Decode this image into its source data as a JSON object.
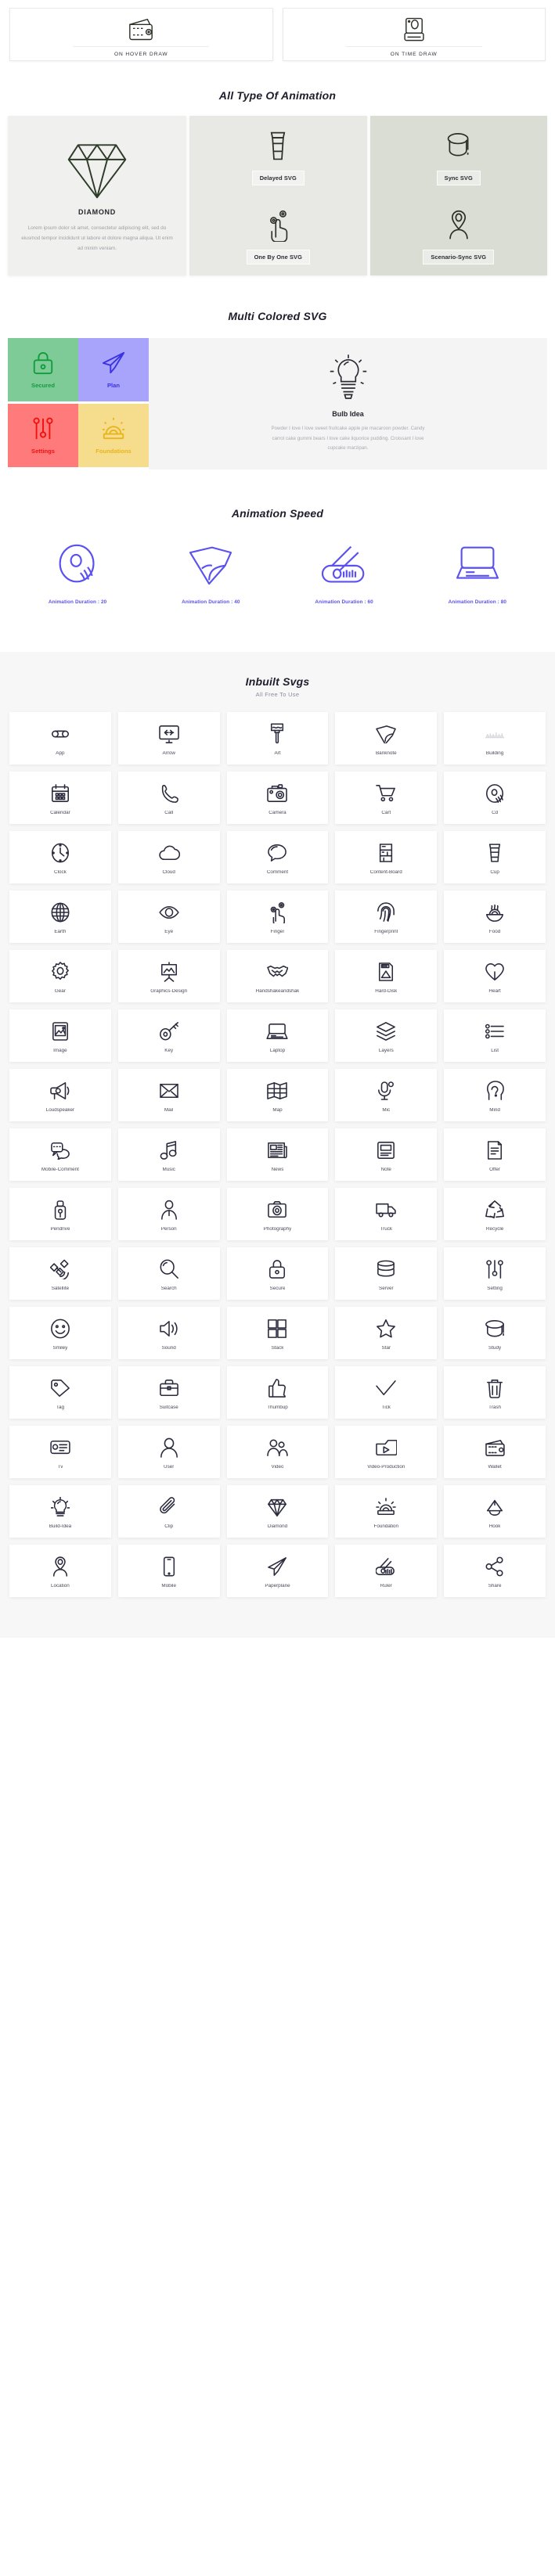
{
  "draw_cards": [
    {
      "label": "ON HOVER DRAW",
      "icon": "wallet-icon"
    },
    {
      "label": "ON TIME DRAW",
      "icon": "camera-icon"
    }
  ],
  "animation_types": {
    "title": "All Type Of Animation",
    "feature": {
      "icon": "diamond-icon",
      "title": "DIAMOND",
      "body": "Lorem ipsum dolor sit amet, consectetur adipiscing elit, sed do eiusmod tempor incididunt ut labore et dolore magna aliqua. Ut enim ad minim veniam."
    },
    "columns": [
      {
        "cells": [
          {
            "icon": "coffee-cup-icon",
            "label": "Delayed SVG"
          },
          {
            "icon": "finger-tap-icon",
            "label": "One By One SVG"
          }
        ]
      },
      {
        "cells": [
          {
            "icon": "graduation-cap-icon",
            "label": "Sync SVG"
          },
          {
            "icon": "location-person-icon",
            "label": "Scenario-Sync SVG"
          }
        ]
      }
    ]
  },
  "multi_colored": {
    "title": "Multi Colored SVG",
    "tiles": [
      {
        "label": "Secured",
        "icon": "lock-icon",
        "bg": "#7ECB97",
        "fg": "#0F9D3C"
      },
      {
        "label": "Plan",
        "icon": "paperplane-icon",
        "bg": "#A8A3FB",
        "fg": "#3B33E0"
      },
      {
        "label": "Settings",
        "icon": "sliders-icon",
        "bg": "#FF7B7B",
        "fg": "#F01010"
      },
      {
        "label": "Foundations",
        "icon": "siren-icon",
        "bg": "#F6DC8D",
        "fg": "#E8B61C"
      }
    ],
    "panel": {
      "icon": "bulb-icon",
      "title": "Bulb Idea",
      "body": "Powder I love I love sweet fruitcake apple pie macaroon powder. Candy carrot cake gummi bears I love cake liquorice pudding. Croissant I love cupcake marzipan."
    }
  },
  "animation_speed": {
    "title": "Animation Speed",
    "accent": "#5A51F0",
    "items": [
      {
        "icon": "cd-icon",
        "label": "Animation Duration : 20"
      },
      {
        "icon": "banknote-icon",
        "label": "Animation Duration : 40"
      },
      {
        "icon": "ruler-icon",
        "label": "Animation Duration : 60"
      },
      {
        "icon": "laptop-icon",
        "label": "Animation Duration : 80"
      }
    ]
  },
  "inbuilt": {
    "title": "Inbuilt Svgs",
    "subtitle": "All Free To Use",
    "icons": [
      {
        "label": "App",
        "icon": "app-icon"
      },
      {
        "label": "Arrow",
        "icon": "arrow-icon"
      },
      {
        "label": "Art",
        "icon": "art-icon"
      },
      {
        "label": "Banknote",
        "icon": "banknote-icon"
      },
      {
        "label": "Building",
        "icon": "building-icon"
      },
      {
        "label": "Calendar",
        "icon": "calendar-icon"
      },
      {
        "label": "Call",
        "icon": "call-icon"
      },
      {
        "label": "Camera",
        "icon": "camera-icon"
      },
      {
        "label": "Cart",
        "icon": "cart-icon"
      },
      {
        "label": "Cd",
        "icon": "cd-icon"
      },
      {
        "label": "Clock",
        "icon": "clock-icon"
      },
      {
        "label": "Cloud",
        "icon": "cloud-icon"
      },
      {
        "label": "Comment",
        "icon": "comment-icon"
      },
      {
        "label": "Content-Board",
        "icon": "content-board-icon"
      },
      {
        "label": "Cup",
        "icon": "cup-icon"
      },
      {
        "label": "Earth",
        "icon": "earth-icon"
      },
      {
        "label": "Eye",
        "icon": "eye-icon"
      },
      {
        "label": "Finger",
        "icon": "finger-icon"
      },
      {
        "label": "Fingerprint",
        "icon": "fingerprint-icon"
      },
      {
        "label": "Food",
        "icon": "food-icon"
      },
      {
        "label": "Gear",
        "icon": "gear-icon"
      },
      {
        "label": "Graphics-Design",
        "icon": "graphics-design-icon"
      },
      {
        "label": "Handshakeandshak",
        "icon": "handshake-icon"
      },
      {
        "label": "Hard-Disk",
        "icon": "hard-disk-icon"
      },
      {
        "label": "Heart",
        "icon": "heart-icon"
      },
      {
        "label": "Image",
        "icon": "image-icon"
      },
      {
        "label": "Key",
        "icon": "key-icon"
      },
      {
        "label": "Laptop",
        "icon": "laptop-icon"
      },
      {
        "label": "Layers",
        "icon": "layers-icon"
      },
      {
        "label": "List",
        "icon": "list-icon"
      },
      {
        "label": "Loudspeaker",
        "icon": "loudspeaker-icon"
      },
      {
        "label": "Mail",
        "icon": "mail-icon"
      },
      {
        "label": "Map",
        "icon": "map-icon"
      },
      {
        "label": "Mic",
        "icon": "mic-icon"
      },
      {
        "label": "Mind",
        "icon": "mind-icon"
      },
      {
        "label": "Mobile-Comment",
        "icon": "mobile-comment-icon"
      },
      {
        "label": "Music",
        "icon": "music-icon"
      },
      {
        "label": "News",
        "icon": "news-icon"
      },
      {
        "label": "Note",
        "icon": "note-icon"
      },
      {
        "label": "Offer",
        "icon": "offer-icon"
      },
      {
        "label": "Pendrive",
        "icon": "pendrive-icon"
      },
      {
        "label": "Person",
        "icon": "person-icon"
      },
      {
        "label": "Photography",
        "icon": "photography-icon"
      },
      {
        "label": "Truck",
        "icon": "truck-icon"
      },
      {
        "label": "Recycle",
        "icon": "recycle-icon"
      },
      {
        "label": "Satellite",
        "icon": "satellite-icon"
      },
      {
        "label": "Search",
        "icon": "search-icon"
      },
      {
        "label": "Secure",
        "icon": "secure-icon"
      },
      {
        "label": "Server",
        "icon": "server-icon"
      },
      {
        "label": "Setting",
        "icon": "setting-icon"
      },
      {
        "label": "Smiley",
        "icon": "smiley-icon"
      },
      {
        "label": "Sound",
        "icon": "sound-icon"
      },
      {
        "label": "Stack",
        "icon": "stack-icon"
      },
      {
        "label": "Star",
        "icon": "star-icon"
      },
      {
        "label": "Study",
        "icon": "study-icon"
      },
      {
        "label": "Tag",
        "icon": "tag-icon"
      },
      {
        "label": "Suitcase",
        "icon": "suitcase-icon"
      },
      {
        "label": "Thumbup",
        "icon": "thumbup-icon"
      },
      {
        "label": "Tick",
        "icon": "tick-icon"
      },
      {
        "label": "Trash",
        "icon": "trash-icon"
      },
      {
        "label": "Tv",
        "icon": "tv-icon"
      },
      {
        "label": "User",
        "icon": "user-icon"
      },
      {
        "label": "Video",
        "icon": "video-icon"
      },
      {
        "label": "Video-Production",
        "icon": "video-production-icon"
      },
      {
        "label": "Wallet",
        "icon": "wallet-icon"
      },
      {
        "label": "Build-Idea",
        "icon": "build-idea-icon"
      },
      {
        "label": "Clip",
        "icon": "clip-icon"
      },
      {
        "label": "Diamond",
        "icon": "diamond-icon"
      },
      {
        "label": "Foundation",
        "icon": "foundation-icon"
      },
      {
        "label": "Hook",
        "icon": "hook-icon"
      },
      {
        "label": "Location",
        "icon": "location-icon"
      },
      {
        "label": "Mobile",
        "icon": "mobile-icon"
      },
      {
        "label": "Paperplane",
        "icon": "paperplane-icon"
      },
      {
        "label": "Ruler",
        "icon": "ruler-icon"
      },
      {
        "label": "Share",
        "icon": "share-icon"
      }
    ]
  }
}
